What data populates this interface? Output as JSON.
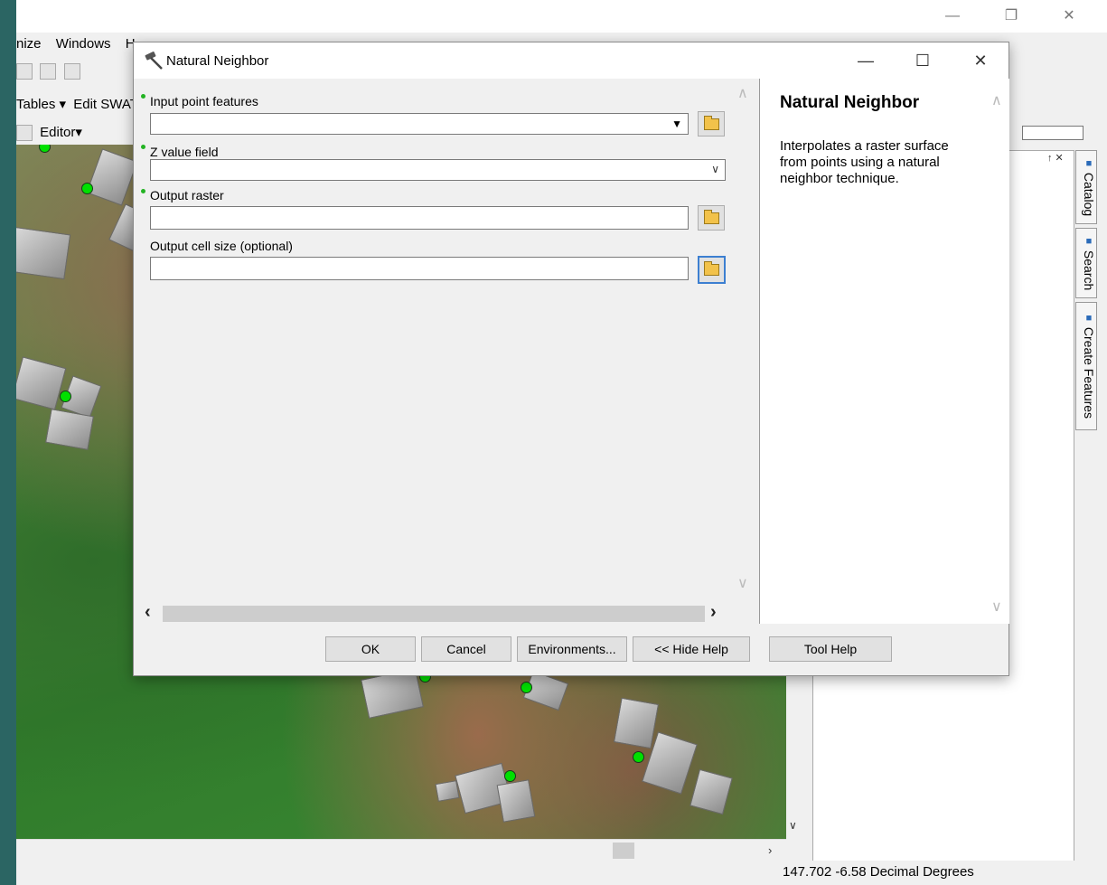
{
  "app": {
    "menu": [
      "nize",
      "Windows",
      "H"
    ],
    "toolbar_tables": "Tables ▾",
    "toolbar_edit": "Edit SWAT",
    "toolbar_editor": "Editor▾",
    "window_minimize": "—",
    "window_restore": "❐",
    "window_close": "✕",
    "status": "147.702  -6.58 Decimal Degrees",
    "dock_pin": "↑ ✕",
    "side_tabs": [
      "Catalog",
      "Search",
      "Create Features"
    ]
  },
  "dialog": {
    "title": "Natural Neighbor",
    "minimize": "—",
    "maximize": "☐",
    "close": "✕",
    "params": [
      {
        "label": "Input point features",
        "required": true,
        "value": ""
      },
      {
        "label": "Z value field",
        "required": true,
        "value": ""
      },
      {
        "label": "Output raster",
        "required": true,
        "value": ""
      },
      {
        "label": "Output cell size (optional)",
        "required": false,
        "value": ""
      }
    ],
    "help": {
      "title": "Natural Neighbor",
      "text": "Interpolates a raster surface from points using a natural neighbor technique."
    },
    "buttons": {
      "ok": "OK",
      "cancel": "Cancel",
      "environments": "Environments...",
      "hide_help": "<< Hide Help",
      "tool_help": "Tool Help"
    }
  },
  "icons": {
    "tool": "hammer-icon",
    "browse": "folder-open-icon",
    "dropdown": "chevron-down-icon"
  }
}
